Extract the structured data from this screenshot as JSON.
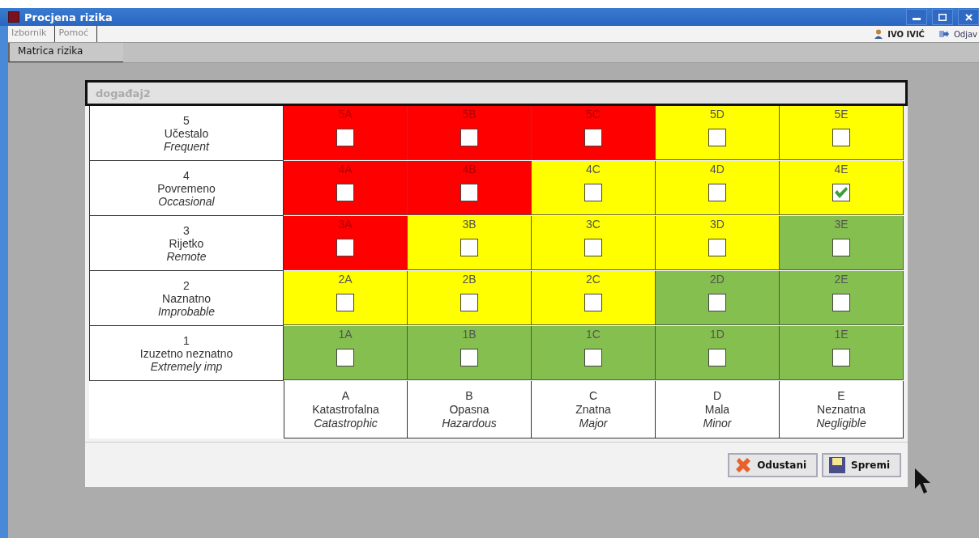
{
  "window": {
    "title": "Procjena rizika"
  },
  "menu": [
    {
      "label": "Izbornik"
    },
    {
      "label": "Pomoć"
    }
  ],
  "user": {
    "name": "IVO IVIĆ",
    "logout": "Odjav"
  },
  "tabs": [
    {
      "label": "Matrica rizika",
      "selected": true
    }
  ],
  "event_field": {
    "value": "događaj2"
  },
  "matrix": {
    "rows": [
      {
        "header": {
          "number": "5",
          "name": "Učestalo",
          "english": "Frequent"
        },
        "cells": [
          {
            "label": "5A",
            "color": "#ff0000",
            "checked": false
          },
          {
            "label": "5B",
            "color": "#ff0000",
            "checked": false
          },
          {
            "label": "5C",
            "color": "#ff0000",
            "checked": false
          },
          {
            "label": "5D",
            "color": "#ffff00",
            "checked": false
          },
          {
            "label": "5E",
            "color": "#ffff00",
            "checked": false
          }
        ]
      },
      {
        "header": {
          "number": "4",
          "name": "Povremeno",
          "english": "Occasional"
        },
        "cells": [
          {
            "label": "4A",
            "color": "#ff0000",
            "checked": false
          },
          {
            "label": "4B",
            "color": "#ff0000",
            "checked": false
          },
          {
            "label": "4C",
            "color": "#ffff00",
            "checked": false
          },
          {
            "label": "4D",
            "color": "#ffff00",
            "checked": false
          },
          {
            "label": "4E",
            "color": "#ffff00",
            "checked": true
          }
        ]
      },
      {
        "header": {
          "number": "3",
          "name": "Rijetko",
          "english": "Remote"
        },
        "cells": [
          {
            "label": "3A",
            "color": "#ff0000",
            "checked": false
          },
          {
            "label": "3B",
            "color": "#ffff00",
            "checked": false
          },
          {
            "label": "3C",
            "color": "#ffff00",
            "checked": false
          },
          {
            "label": "3D",
            "color": "#ffff00",
            "checked": false
          },
          {
            "label": "3E",
            "color": "#84bf50",
            "checked": false
          }
        ]
      },
      {
        "header": {
          "number": "2",
          "name": "Naznatno",
          "english": "Improbable"
        },
        "cells": [
          {
            "label": "2A",
            "color": "#ffff00",
            "checked": false
          },
          {
            "label": "2B",
            "color": "#ffff00",
            "checked": false
          },
          {
            "label": "2C",
            "color": "#ffff00",
            "checked": false
          },
          {
            "label": "2D",
            "color": "#84bf50",
            "checked": false
          },
          {
            "label": "2E",
            "color": "#84bf50",
            "checked": false
          }
        ]
      },
      {
        "header": {
          "number": "1",
          "name": "Izuzetno neznatno",
          "english": "Extremely imp"
        },
        "cells": [
          {
            "label": "1A",
            "color": "#84bf50",
            "checked": false
          },
          {
            "label": "1B",
            "color": "#84bf50",
            "checked": false
          },
          {
            "label": "1C",
            "color": "#84bf50",
            "checked": false
          },
          {
            "label": "1D",
            "color": "#84bf50",
            "checked": false
          },
          {
            "label": "1E",
            "color": "#84bf50",
            "checked": false
          }
        ]
      }
    ],
    "severity_footer": [
      {
        "letter": "A",
        "name": "Katastrofalna",
        "english": "Catastrophic"
      },
      {
        "letter": "B",
        "name": "Opasna",
        "english": "Hazardous"
      },
      {
        "letter": "C",
        "name": "Znatna",
        "english": "Major"
      },
      {
        "letter": "D",
        "name": "Mala",
        "english": "Minor"
      },
      {
        "letter": "E",
        "name": "Neznatna",
        "english": "Negligible"
      }
    ]
  },
  "buttons": [
    {
      "kind": "cancel",
      "label": "Odustani"
    },
    {
      "kind": "save",
      "label": "Spremi"
    }
  ]
}
